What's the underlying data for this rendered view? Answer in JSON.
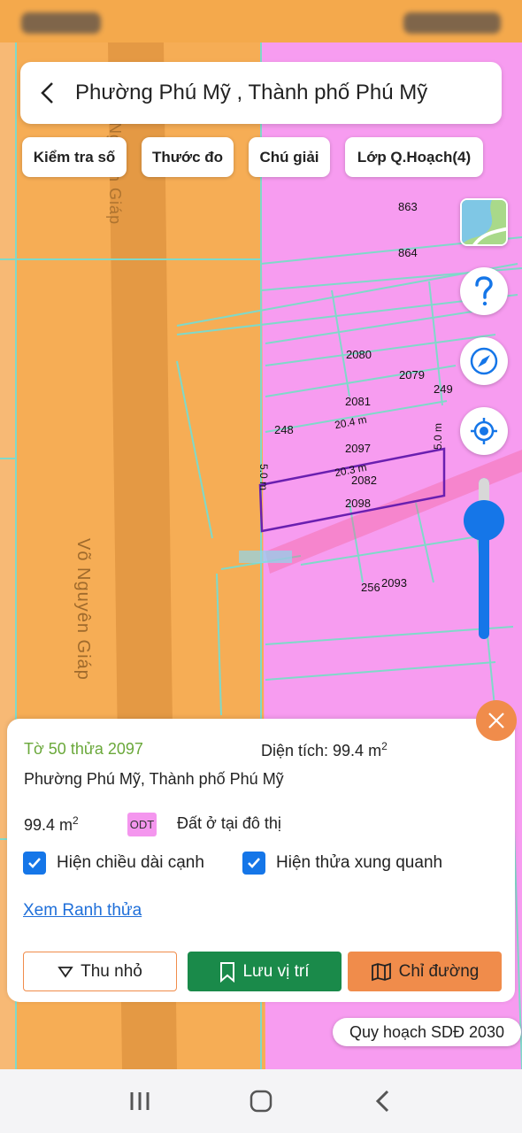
{
  "header": {
    "title": "Phường Phú Mỹ , Thành phố Phú Mỹ"
  },
  "chips": [
    {
      "label": "Kiểm tra số"
    },
    {
      "label": "Thước đo"
    },
    {
      "label": "Chú giải"
    },
    {
      "label": "Lớp Q.Hoạch(4)"
    }
  ],
  "map": {
    "road_name": "Võ Nguyên Giáp",
    "road_name_top": "Võ Nguyên Giáp",
    "parcels": [
      "863",
      "864",
      "2080",
      "2079",
      "249",
      "2081",
      "248",
      "2097",
      "2082",
      "2098",
      "256",
      "2093"
    ],
    "dimensions": [
      "20.4 m",
      "20.3 m",
      "5.0 m",
      "5.0 m"
    ],
    "colors": {
      "residential_planned": "#f6ad55",
      "urban_residential": "#f79cf0",
      "road": "#e0983c",
      "parcel_outline": "#7fd9c9",
      "selected_outline": "#6a1fb0"
    }
  },
  "card": {
    "ref": "Tờ 50 thửa 2097",
    "area_label": "Diện tích: 99.4 m",
    "area_sup": "2",
    "address": "Phường Phú Mỹ, Thành phố Phú Mỹ",
    "area_value": "99.4 m",
    "area_value_sup": "2",
    "land_code": "ODT",
    "land_type": "Đất ở tại đô thị",
    "check_edges": "Hiện chiều dài cạnh",
    "check_neighbors": "Hiện thửa xung quanh",
    "link": "Xem Ranh thửa",
    "btn_shrink": "Thu nhỏ",
    "btn_save": "Lưu vị trí",
    "btn_route": "Chỉ đường"
  },
  "plan_chip": "Quy hoạch SDĐ 2030",
  "icons": [
    "back-arrow-icon",
    "map-layer-icon",
    "help-icon",
    "compass-icon",
    "my-location-icon",
    "close-icon",
    "triangle-down-icon",
    "bookmark-icon",
    "map-icon",
    "recent-apps-icon",
    "home-icon",
    "back-nav-icon"
  ]
}
